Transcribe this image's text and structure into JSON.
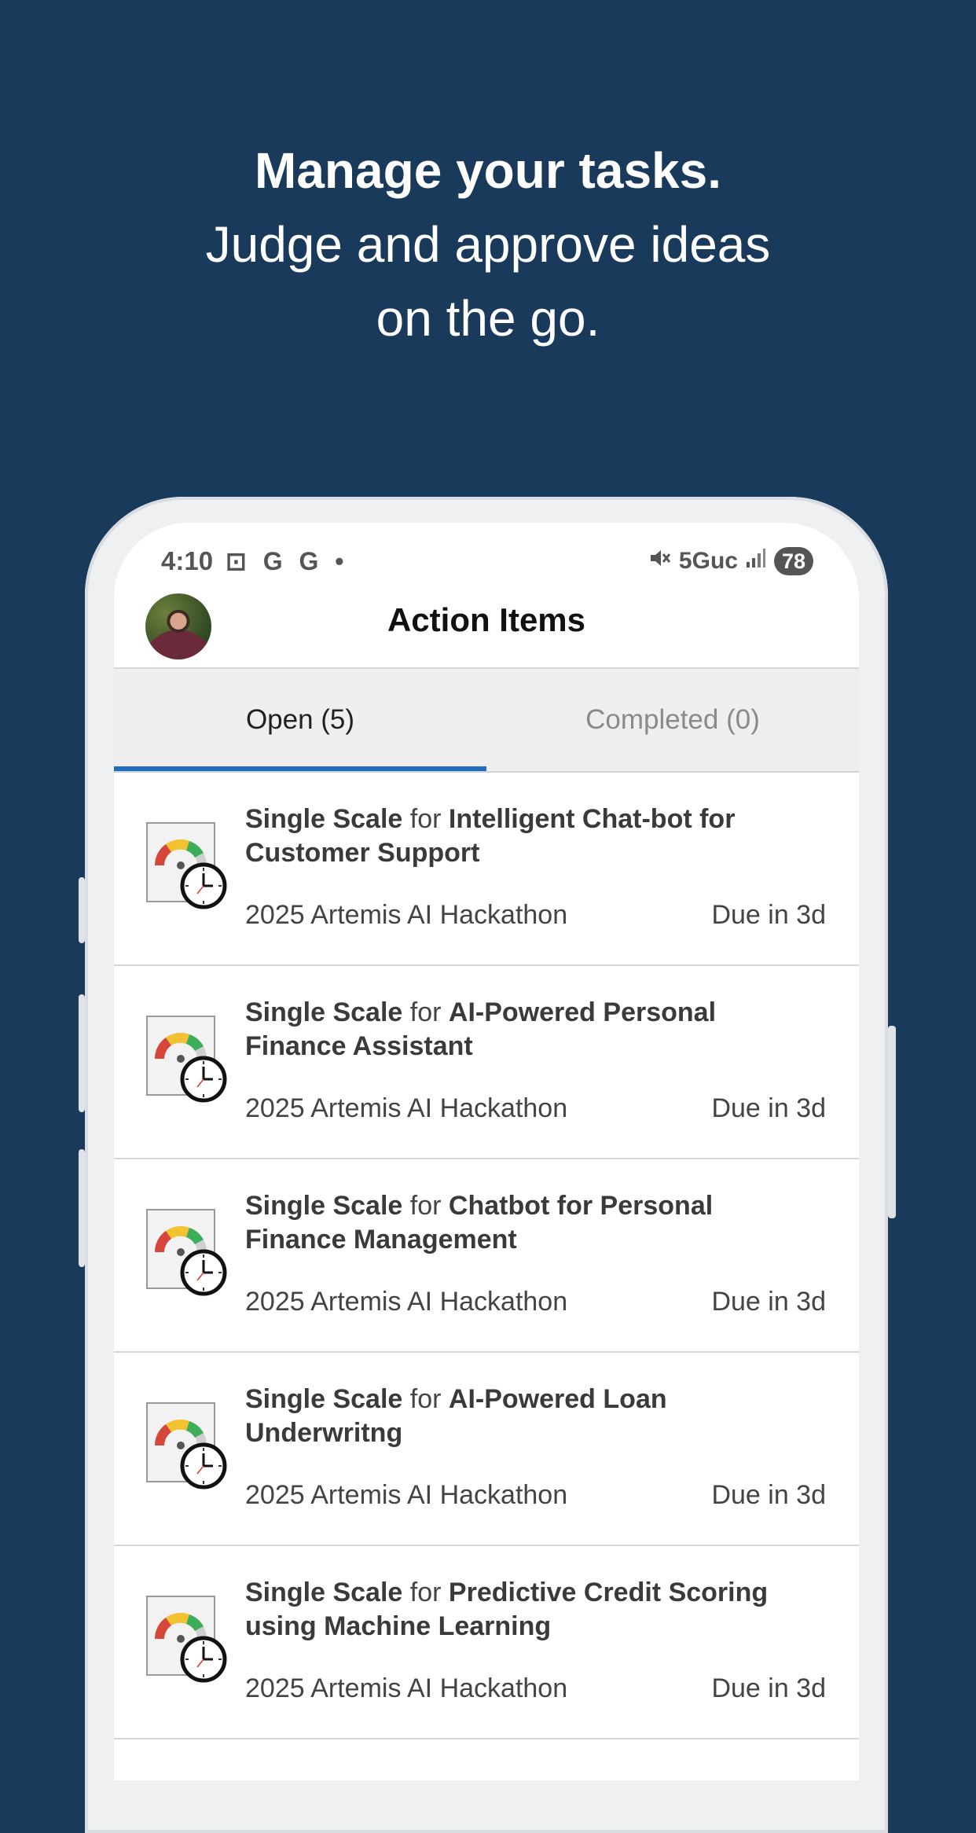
{
  "promo": {
    "line1": "Manage your tasks.",
    "line2": "Judge and approve ideas",
    "line3": "on the go."
  },
  "status_bar": {
    "time": "4:10",
    "left_icons": "⊡ G G •",
    "network": "5Guc",
    "battery": "78"
  },
  "app_bar": {
    "title": "Action Items"
  },
  "tabs": [
    {
      "label": "Open (5)",
      "selected": true
    },
    {
      "label": "Completed (0)",
      "selected": false
    }
  ],
  "items": [
    {
      "type": "Single Scale",
      "connector": "for",
      "idea": "Intelligent Chat-bot for Customer Support",
      "event": "2025 Artemis AI Hackathon",
      "due": "Due in 3d"
    },
    {
      "type": "Single Scale",
      "connector": "for",
      "idea": "AI-Powered Personal Finance Assistant",
      "event": "2025 Artemis AI Hackathon",
      "due": "Due in 3d"
    },
    {
      "type": "Single Scale",
      "connector": "for",
      "idea": "Chatbot for Personal Finance Management",
      "event": "2025 Artemis AI Hackathon",
      "due": "Due in 3d"
    },
    {
      "type": "Single Scale",
      "connector": "for",
      "idea": "AI-Powered Loan Underwritng",
      "event": "2025 Artemis AI Hackathon",
      "due": "Due in 3d"
    },
    {
      "type": "Single Scale",
      "connector": "for",
      "idea": "Predictive Credit Scoring using Machine Learning",
      "event": "2025 Artemis AI Hackathon",
      "due": "Due in 3d"
    }
  ],
  "colors": {
    "background": "#1a3a5c",
    "tab_indicator": "#1f6fc0"
  }
}
